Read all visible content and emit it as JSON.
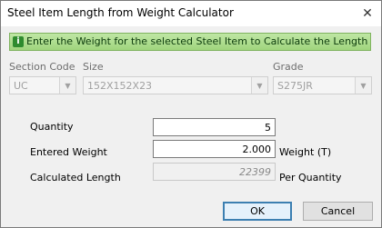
{
  "window": {
    "title": "Steel Item Length from Weight Calculator",
    "close_glyph": "✕"
  },
  "banner": {
    "icon": "info-icon",
    "text": "Enter the Weight for the selected Steel Item to Calculate the Length",
    "color": "#9fd57d"
  },
  "selectors": {
    "section_code": {
      "label": "Section Code",
      "value": "UC"
    },
    "size": {
      "label": "Size",
      "value": "152X152X23"
    },
    "grade": {
      "label": "Grade",
      "value": "S275JR"
    }
  },
  "form": {
    "quantity": {
      "label": "Quantity",
      "value": "5"
    },
    "weight": {
      "label": "Entered Weight",
      "value": "2.000",
      "suffix": "Weight (T)"
    },
    "length": {
      "label": "Calculated Length",
      "value": "22399",
      "suffix": "Per Quantity"
    }
  },
  "buttons": {
    "ok": "OK",
    "cancel": "Cancel"
  }
}
